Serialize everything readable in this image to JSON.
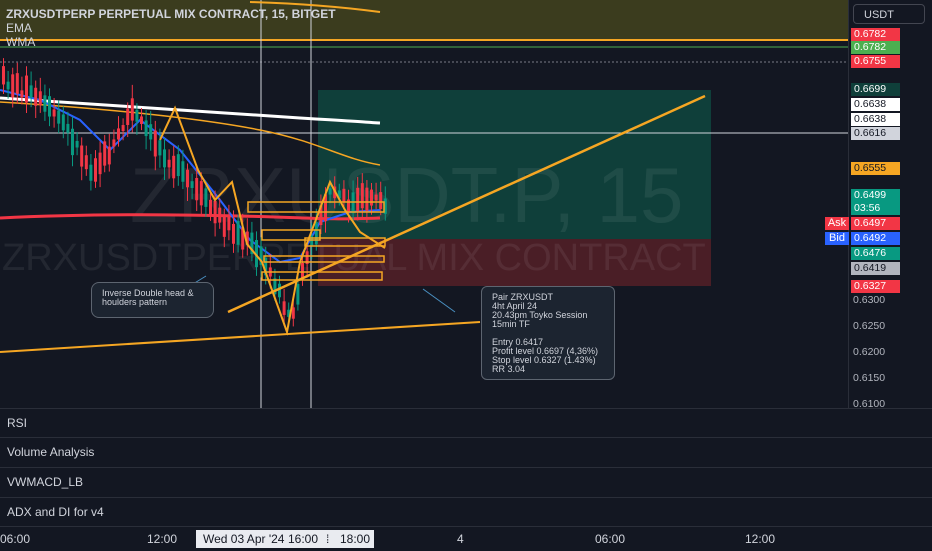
{
  "chart": {
    "title": "ZRXUSDTPERP PERPETUAL MIX CONTRACT, 15, BITGET",
    "indicators": [
      "EMA",
      "WMA"
    ],
    "watermark_big": "ZRXUSDT.P, 15",
    "watermark_small": "ZRXUSDTPERPETUAL MIX CONTRACT"
  },
  "price_axis": {
    "currency": "USDT",
    "labels": [
      {
        "text": "0.6782",
        "color": "#f23645"
      },
      {
        "text": "0.6782",
        "color": "#4caf50"
      },
      {
        "text": "0.6755",
        "color": "#f23645"
      },
      {
        "text": "0.6699",
        "color": "#0f3f3a"
      },
      {
        "text": "0.6638",
        "color": "#ffffff"
      },
      {
        "text": "0.6638",
        "color": "#ffffff"
      },
      {
        "text": "0.6616",
        "color": "#d1d4dc"
      },
      {
        "text": "0.6555",
        "color": "#f5a623"
      },
      {
        "text": "0.6499",
        "color": "#089981"
      },
      {
        "text": "03:56",
        "color": "#089981"
      },
      {
        "text": "0.6497",
        "color": "#f23645"
      },
      {
        "text": "0.6492",
        "color": "#2962ff"
      },
      {
        "text": "0.6476",
        "color": "#089981"
      },
      {
        "text": "0.6419",
        "color": "#b2b5be"
      },
      {
        "text": "0.6327",
        "color": "#f23645"
      }
    ],
    "ticks": [
      "0.6300",
      "0.6250",
      "0.6200",
      "0.6150",
      "0.6100"
    ],
    "ask_label": "Ask",
    "bid_label": "Bid"
  },
  "annotations": {
    "pattern_note": [
      "Inverse Double head &",
      "houlders pattern"
    ],
    "trade_note": [
      "Pair ZRXUSDT",
      "4ht April 24",
      "20.43pm Toyko Session",
      "15min TF",
      "",
      "Entry 0.6417",
      "Profit level 0.6697 (4,36%)",
      "Stop level 0.6327 (1.43%)",
      "RR 3.04"
    ]
  },
  "panes": [
    "RSI",
    "Volume Analysis",
    "VWMACD_LB",
    "ADX and DI for v4"
  ],
  "time_axis": {
    "labels": [
      "06:00",
      "12:00",
      "4",
      "06:00",
      "12:00"
    ],
    "cursor_date": "Wed 03 Apr '24",
    "cursor_times": [
      "16:00",
      "18:00"
    ]
  },
  "colors": {
    "background": "#131722",
    "up": "#089981",
    "down": "#f23645",
    "trendline": "#f5a623",
    "profit_zone": "#0f3f3a",
    "stop_zone": "#4a1e26"
  }
}
